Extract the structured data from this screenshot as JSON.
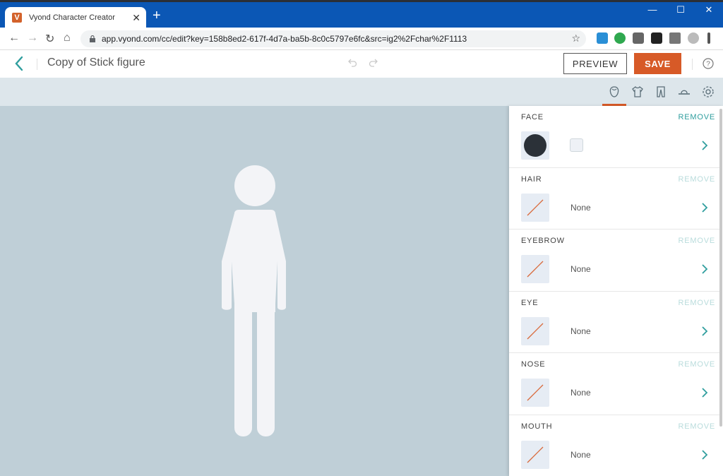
{
  "browser": {
    "tab_title": "Vyond Character Creator",
    "favicon_letter": "V",
    "url": "app.vyond.com/cc/edit?key=158b8ed2-617f-4d7a-ba5b-8c0c5797e6fc&src=ig2%2Fchar%2F1113"
  },
  "header": {
    "title": "Copy of Stick figure",
    "preview_label": "PREVIEW",
    "save_label": "SAVE"
  },
  "toolbar": {
    "icons": [
      "face-icon",
      "shirt-icon",
      "pants-icon",
      "hat-icon",
      "settings-icon"
    ],
    "active": "face-icon"
  },
  "panel": {
    "sections": [
      {
        "label": "FACE",
        "remove": "REMOVE",
        "value": "",
        "remove_enabled": true,
        "thumb": "dark-circle"
      },
      {
        "label": "HAIR",
        "remove": "REMOVE",
        "value": "None",
        "remove_enabled": false,
        "thumb": "none-slash"
      },
      {
        "label": "EYEBROW",
        "remove": "REMOVE",
        "value": "None",
        "remove_enabled": false,
        "thumb": "none-slash"
      },
      {
        "label": "EYE",
        "remove": "REMOVE",
        "value": "None",
        "remove_enabled": false,
        "thumb": "none-slash"
      },
      {
        "label": "NOSE",
        "remove": "REMOVE",
        "value": "None",
        "remove_enabled": false,
        "thumb": "none-slash"
      },
      {
        "label": "MOUTH",
        "remove": "REMOVE",
        "value": "None",
        "remove_enabled": false,
        "thumb": "none-slash"
      }
    ]
  },
  "colors": {
    "accent_orange": "#d75a27",
    "teal_remove": "#2f9e9e",
    "canvas_bg": "#bfcfd7",
    "figure_fill": "#f3f4f7"
  }
}
